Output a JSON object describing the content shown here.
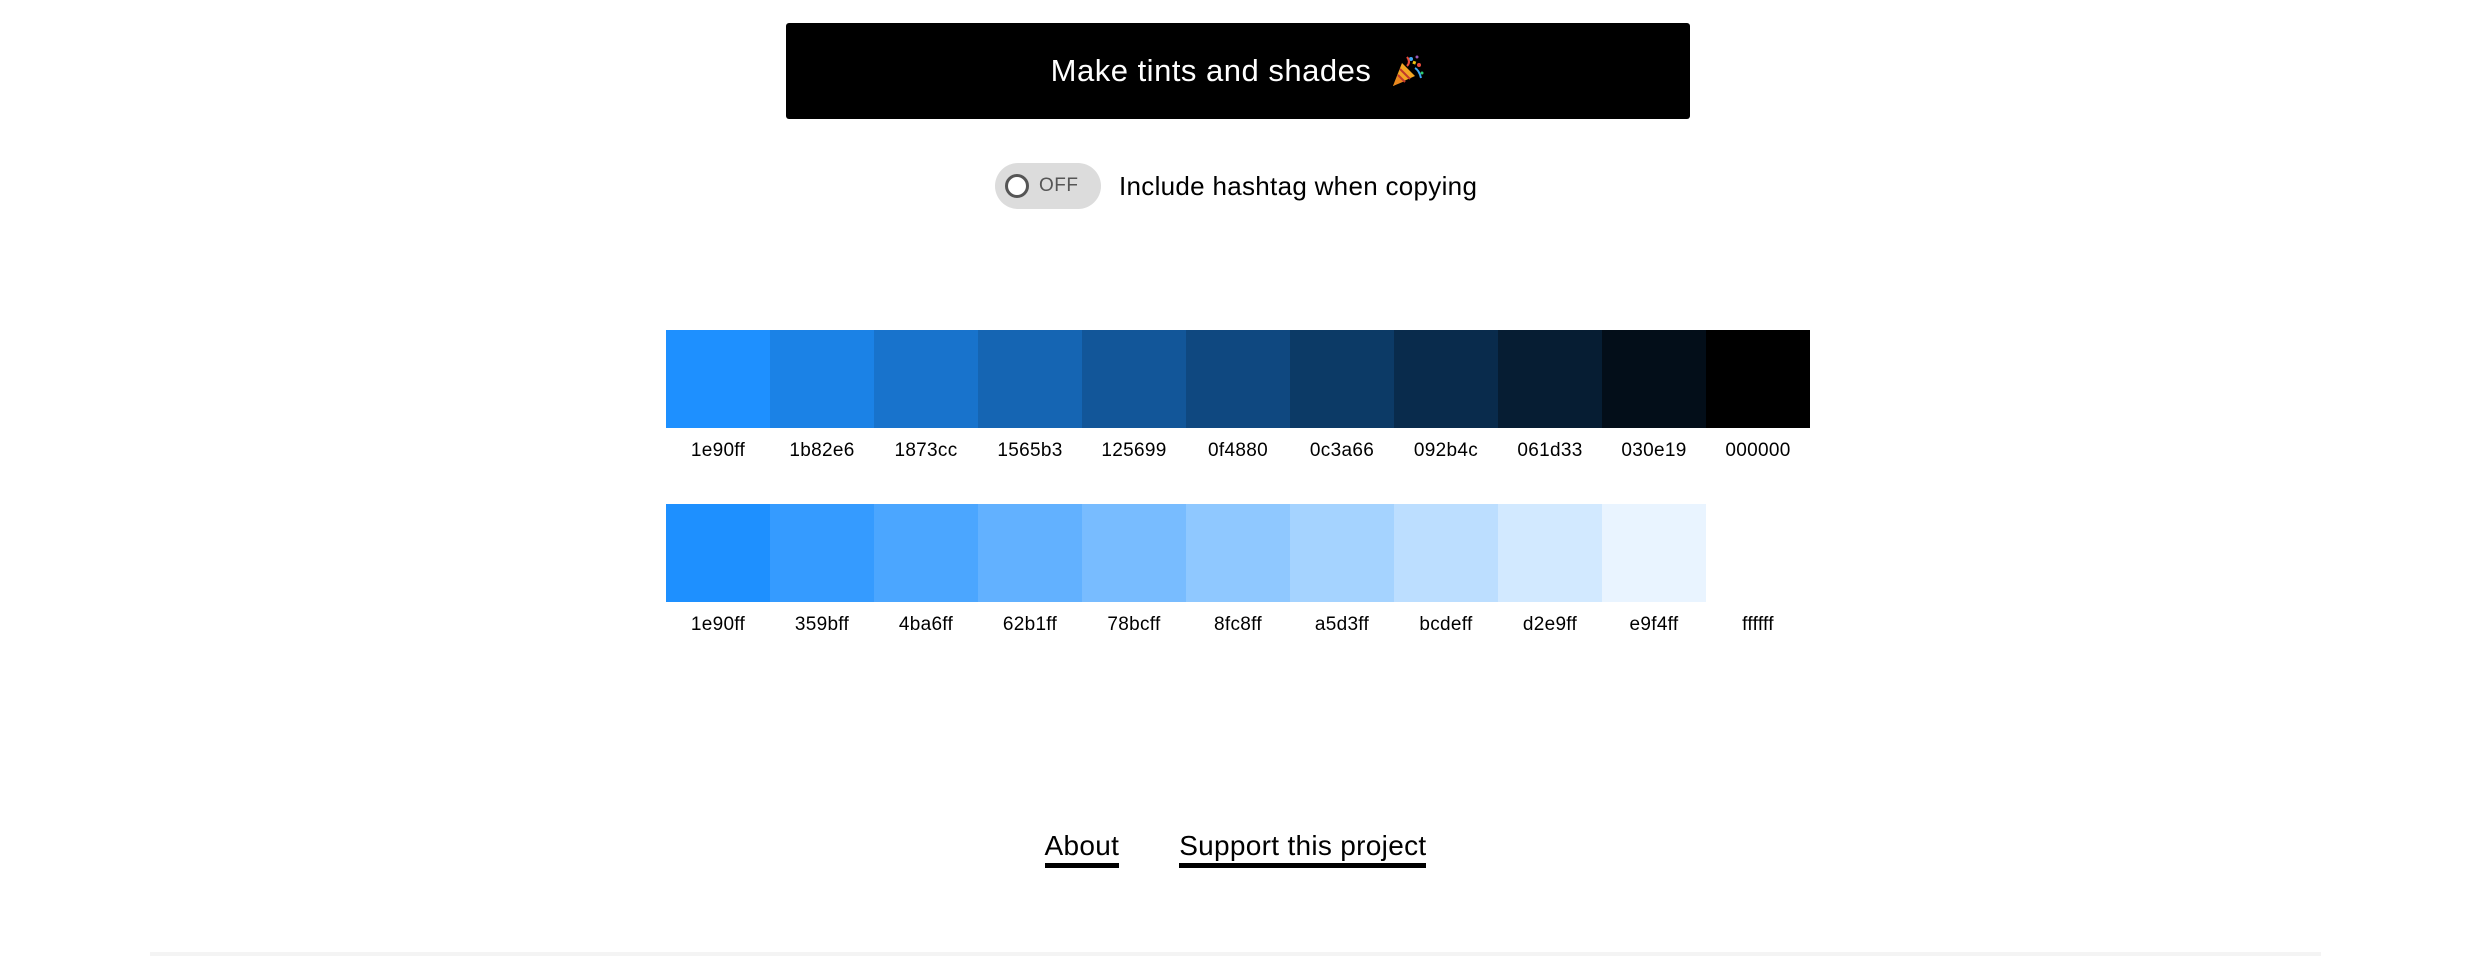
{
  "action": {
    "make_label": "Make tints and shades",
    "icon": "party-popper-icon"
  },
  "hashtag_toggle": {
    "state_label": "OFF",
    "label": "Include hashtag when copying",
    "on": false
  },
  "shades": {
    "colors": [
      "#1e90ff",
      "#1b82e6",
      "#1873cc",
      "#1565b3",
      "#125699",
      "#0f4880",
      "#0c3a66",
      "#092b4c",
      "#061d33",
      "#030e19",
      "#000000"
    ],
    "labels": [
      "1e90ff",
      "1b82e6",
      "1873cc",
      "1565b3",
      "125699",
      "0f4880",
      "0c3a66",
      "092b4c",
      "061d33",
      "030e19",
      "000000"
    ]
  },
  "tints": {
    "colors": [
      "#1e90ff",
      "#359bff",
      "#4ba6ff",
      "#62b1ff",
      "#78bcff",
      "#8fc8ff",
      "#a5d3ff",
      "#bcdeff",
      "#d2e9ff",
      "#e9f4ff",
      "#ffffff"
    ],
    "labels": [
      "1e90ff",
      "359bff",
      "4ba6ff",
      "62b1ff",
      "78bcff",
      "8fc8ff",
      "a5d3ff",
      "bcdeff",
      "d2e9ff",
      "e9f4ff",
      "ffffff"
    ]
  },
  "footer": {
    "about": "About",
    "support": "Support this project"
  }
}
